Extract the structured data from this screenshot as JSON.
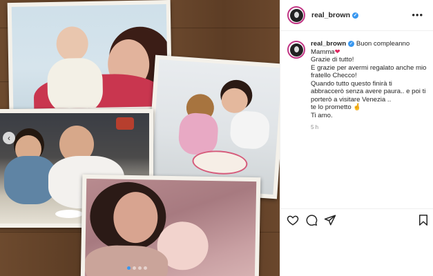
{
  "post": {
    "username": "real_brown",
    "verified_glyph": "✓",
    "more_glyph": "•••",
    "caption_lines": [
      "Buon compleanno",
      "Mamma",
      "Grazie di tutto!",
      "E grazie per avermi regalato anche mio",
      "fratello Checco!",
      "Quando tutto questo finirà ti",
      "abbraccerò senza avere paura.. e poi ti",
      "porterò a visitare Venezia ..",
      "te lo prometto",
      "Ti amo."
    ],
    "heart_glyph": "❤",
    "hand_glyph": "🤞",
    "time": "5 h"
  },
  "carousel": {
    "prev_glyph": "‹",
    "slide_count": 4,
    "active_index": 0
  },
  "icons": [
    "heart-icon",
    "comment-icon",
    "share-icon",
    "bookmark-icon",
    "verified-badge-icon",
    "more-icon"
  ],
  "colors": {
    "accent": "#3897f0",
    "heart": "#e0245e",
    "story_ring": "#c13584"
  }
}
